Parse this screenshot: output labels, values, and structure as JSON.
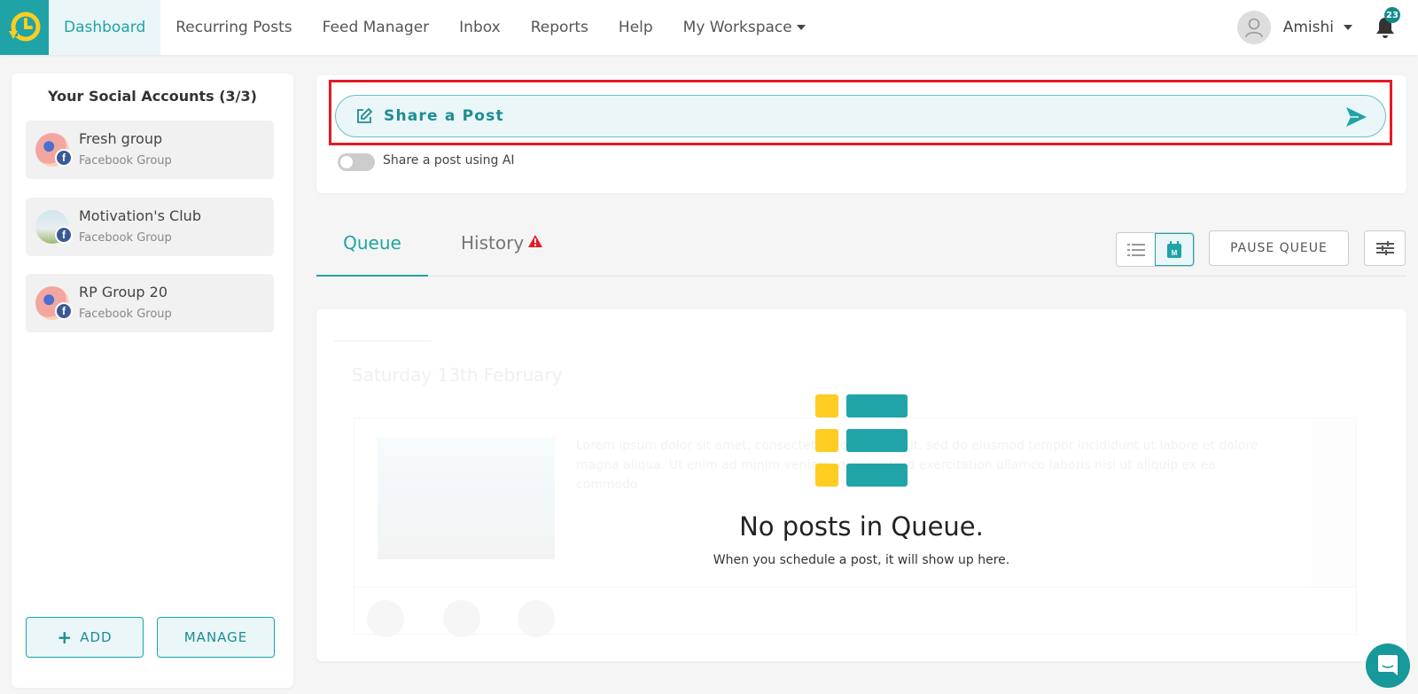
{
  "nav": {
    "logo_icon": "clock-refresh-logo-icon",
    "items": [
      {
        "label": "Dashboard",
        "active": true
      },
      {
        "label": "Recurring Posts"
      },
      {
        "label": "Feed Manager"
      },
      {
        "label": "Inbox"
      },
      {
        "label": "Reports"
      },
      {
        "label": "Help"
      },
      {
        "label": "My Workspace",
        "dropdown": true
      }
    ],
    "user": {
      "name": "Amishi",
      "avatar_icon": "user-icon"
    },
    "notifications": {
      "icon": "bell-icon",
      "count": "23"
    }
  },
  "sidebar": {
    "title": "Your Social Accounts (3/3)",
    "accounts": [
      {
        "name": "Fresh group",
        "type": "Facebook Group",
        "network_icon": "facebook-icon"
      },
      {
        "name": "Motivation's Club",
        "type": "Facebook Group",
        "network_icon": "facebook-icon"
      },
      {
        "name": "RP Group 20",
        "type": "Facebook Group",
        "network_icon": "facebook-icon"
      }
    ],
    "add_label": "ADD",
    "manage_label": "MANAGE"
  },
  "share": {
    "placeholder": "Share a Post",
    "edit_icon": "edit-icon",
    "send_icon": "send-icon",
    "ai_toggle_label": "Share a post using AI",
    "ai_toggle_on": false
  },
  "tabs": {
    "items": [
      {
        "label": "Queue",
        "active": true
      },
      {
        "label": "History",
        "alert": true
      }
    ],
    "pause_label": "PAUSE QUEUE",
    "calendar_badge": "M"
  },
  "queue": {
    "empty_title": "No posts in Queue.",
    "empty_subtitle": "When you schedule a post, it will show up here.",
    "ghost_date": "Saturday 13th February",
    "ghost_text": "Lorem ipsum dolor sit amet, consectetur adipiscing elit, sed do eiusmod tempor incididunt ut labore et dolore magna aliqua. Ut enim ad minim veniam, quis nostrud exercitation ullamco laboris nisi ut aliquip ex ea commodo"
  },
  "colors": {
    "brand": "#1fa3a6",
    "highlight": "#e31b23",
    "accent_yellow": "#fdcd22",
    "facebook": "#3b5998"
  }
}
